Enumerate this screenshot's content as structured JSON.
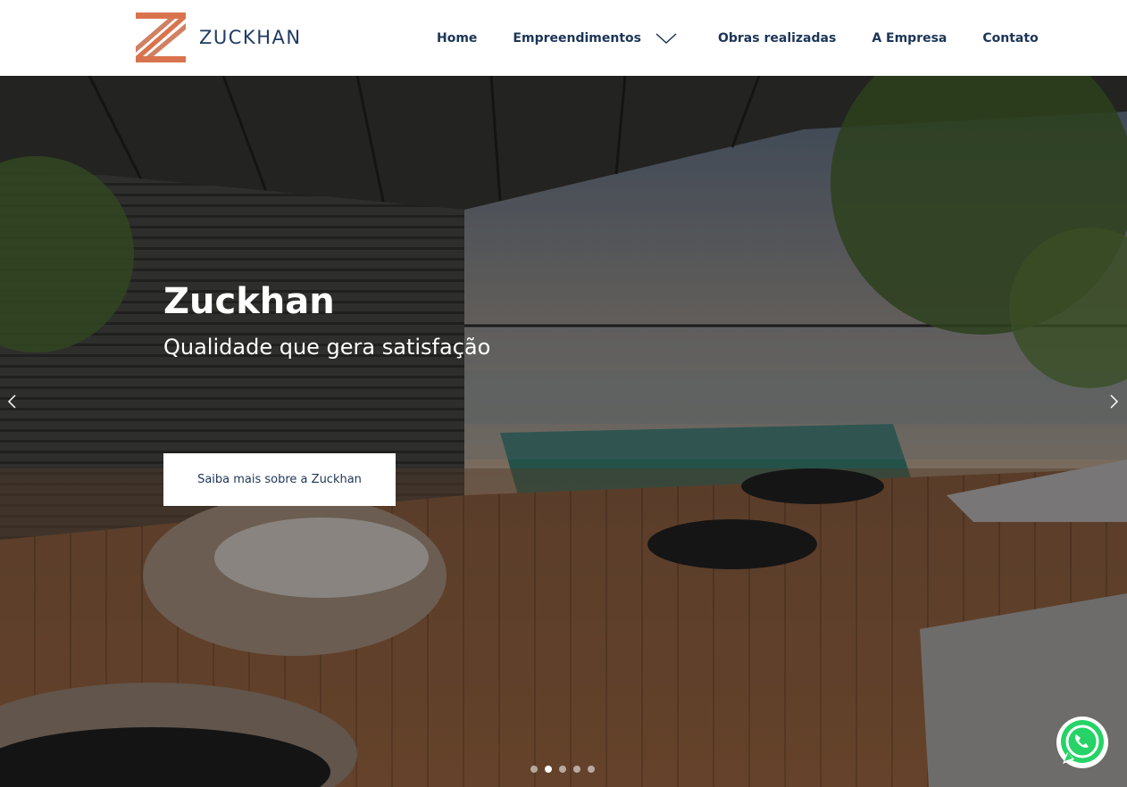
{
  "brand": {
    "name": "ZUCKHAN",
    "colors": {
      "primary": "#1c3557",
      "accent": "#d9734e"
    }
  },
  "nav": {
    "items": [
      {
        "label": "Home"
      },
      {
        "label": "Empreendimentos"
      },
      {
        "label": "Obras realizadas"
      },
      {
        "label": "A Empresa"
      },
      {
        "label": "Contato"
      }
    ],
    "dropdown_icon": "chevron-down-icon"
  },
  "hero": {
    "title": "Zuckhan",
    "subtitle": "Qualidade que gera satisfação",
    "cta_label": "Saiba mais sobre a Zuckhan",
    "slides_count": 5,
    "active_slide": 2,
    "prev_icon": "chevron-left-icon",
    "next_icon": "chevron-right-icon"
  },
  "floating": {
    "icon": "whatsapp-icon",
    "color": "#25d366"
  }
}
